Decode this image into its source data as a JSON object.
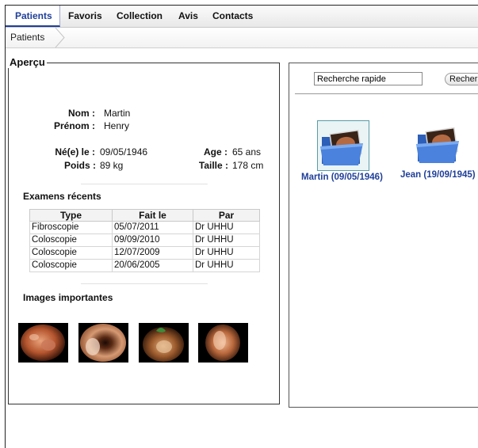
{
  "menu": {
    "tabs": [
      "Patients",
      "Favoris",
      "Collection",
      "Avis",
      "Contacts"
    ],
    "active": "Patients"
  },
  "breadcrumb": {
    "items": [
      "Patients"
    ]
  },
  "overview": {
    "title": "Aperçu",
    "patient": {
      "nom_label": "Nom :",
      "nom": "Martin",
      "prenom_label": "Prénom :",
      "prenom": "Henry",
      "ne_label": "Né(e) le :",
      "ne": "09/05/1946",
      "age_label": "Age :",
      "age": "65 ans",
      "poids_label": "Poids :",
      "poids": "89 kg",
      "taille_label": "Taille :",
      "taille": "178 cm"
    },
    "exams": {
      "title": "Examens récents",
      "headers": [
        "Type",
        "Fait le",
        "Par"
      ],
      "rows": [
        [
          "Fibroscopie",
          "05/07/2011",
          "Dr UHHU"
        ],
        [
          "Coloscopie",
          "09/09/2010",
          "Dr UHHU"
        ],
        [
          "Coloscopie",
          "12/07/2009",
          "Dr UHHU"
        ],
        [
          "Coloscopie",
          "20/06/2005",
          "Dr UHHU"
        ]
      ]
    },
    "images": {
      "title": "Images importantes"
    }
  },
  "search": {
    "value": "Recherche rapide",
    "button_label": "Recherche"
  },
  "patients_list": [
    {
      "label": "Martin (09/05/1946)",
      "selected": true
    },
    {
      "label": "Jean (19/09/1945)",
      "selected": false
    }
  ],
  "colors": {
    "accent": "#1f3f99",
    "folder": "#3b6fc9"
  }
}
